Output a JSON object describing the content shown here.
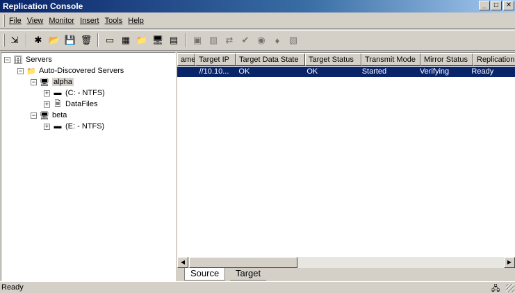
{
  "window": {
    "title": "Replication Console"
  },
  "menu": [
    "File",
    "View",
    "Monitor",
    "Insert",
    "Tools",
    "Help"
  ],
  "toolbar": [
    {
      "icon": "connect-icon",
      "glyph": "⇲"
    },
    {
      "sep": true
    },
    {
      "icon": "new-icon",
      "glyph": "✱"
    },
    {
      "icon": "open-icon",
      "glyph": "📂"
    },
    {
      "icon": "save-icon",
      "glyph": "💾"
    },
    {
      "icon": "delete-icon",
      "glyph": "🗑"
    },
    {
      "sep": true
    },
    {
      "icon": "window-icon",
      "glyph": "▭"
    },
    {
      "icon": "properties-icon",
      "glyph": "▦"
    },
    {
      "icon": "group-icon",
      "glyph": "📁"
    },
    {
      "icon": "server-icon",
      "glyph": "🖥"
    },
    {
      "icon": "log-icon",
      "glyph": "▤"
    },
    {
      "sep": true
    },
    {
      "icon": "start-icon",
      "glyph": "▣",
      "dim": true
    },
    {
      "icon": "stop-icon",
      "glyph": "▥",
      "dim": true
    },
    {
      "icon": "mirror-icon",
      "glyph": "⇄",
      "dim": true
    },
    {
      "icon": "verify-icon",
      "glyph": "✔",
      "dim": true
    },
    {
      "icon": "restore-icon",
      "glyph": "◉",
      "dim": true
    },
    {
      "icon": "pause-icon",
      "glyph": "♦",
      "dim": true
    },
    {
      "icon": "report-icon",
      "glyph": "▧",
      "dim": true
    }
  ],
  "tree": [
    {
      "label": "Servers",
      "level": 0,
      "expander": "−",
      "icon": "servers-icon"
    },
    {
      "label": "Auto-Discovered Servers",
      "level": 1,
      "expander": "−",
      "icon": "folder-icon"
    },
    {
      "label": "alpha",
      "level": 2,
      "expander": "−",
      "icon": "server-node-icon",
      "selected": true
    },
    {
      "label": "(C: - NTFS)",
      "level": 3,
      "expander": "+",
      "icon": "drive-icon"
    },
    {
      "label": "DataFiles",
      "level": 3,
      "expander": "+",
      "icon": "datafile-icon"
    },
    {
      "label": "beta",
      "level": 2,
      "expander": "−",
      "icon": "server-node-icon"
    },
    {
      "label": "(E: - NTFS)",
      "level": 3,
      "expander": "+",
      "icon": "drive-icon"
    }
  ],
  "list": {
    "columns": [
      {
        "label": "ame",
        "width": 26
      },
      {
        "label": "Target IP",
        "width": 58
      },
      {
        "label": "Target Data State",
        "width": 100
      },
      {
        "label": "Target Status",
        "width": 81
      },
      {
        "label": "Transmit Mode",
        "width": 85
      },
      {
        "label": "Mirror Status",
        "width": 76
      },
      {
        "label": "Replication",
        "width": 70
      }
    ],
    "rows": [
      [
        "",
        "//10.10...",
        "OK",
        "OK",
        "Started",
        "Verifying",
        "Ready"
      ]
    ]
  },
  "tabs": {
    "active": "Source",
    "inactive": "Target"
  },
  "status": {
    "text": "Ready"
  }
}
